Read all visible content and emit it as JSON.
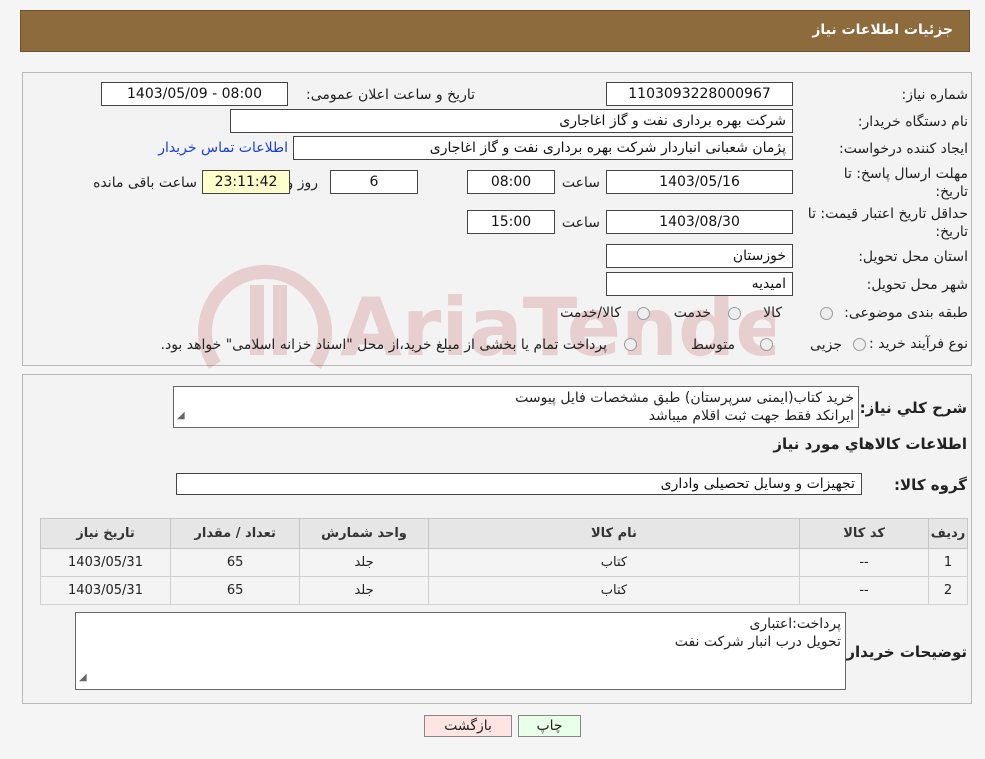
{
  "header": {
    "title": "جزئیات اطلاعات نیاز"
  },
  "form": {
    "need_number_label": "شماره نیاز:",
    "need_number": "1103093228000967",
    "announce_label": "تاریخ و ساعت اعلان عمومی:",
    "announce_value": "1403/05/09 - 08:00",
    "buyer_org_label": "نام دستگاه خریدار:",
    "buyer_org": "شرکت بهره برداری نفت و گاز اغاجاری",
    "creator_label": "ایجاد کننده درخواست:",
    "creator": "پژمان شعبانی انباردار شرکت بهره برداری نفت و گاز اغاجاری",
    "contact_link": "اطلاعات تماس خریدار",
    "deadline_label_1": "مهلت ارسال پاسخ: تا",
    "deadline_label_2": "تاریخ:",
    "deadline_date": "1403/05/16",
    "time_label": "ساعت",
    "deadline_time": "08:00",
    "days_value": "6",
    "days_label": "روز و",
    "remaining_time": "23:11:42",
    "remaining_label": "ساعت باقی مانده",
    "validity_label_1": "حداقل تاریخ اعتبار قیمت: تا",
    "validity_label_2": "تاریخ:",
    "validity_date": "1403/08/30",
    "validity_time": "15:00",
    "province_label": "استان محل تحویل:",
    "province": "خوزستان",
    "city_label": "شهر محل تحویل:",
    "city": "امیدیه",
    "category_label": "طبقه بندی موضوعی:",
    "category_options": [
      "کالا",
      "خدمت",
      "کالا/خدمت"
    ],
    "process_label": "نوع فرآیند خرید :",
    "process_options": [
      "جزیی",
      "متوسط"
    ],
    "process_note": "پرداخت تمام یا بخشی از مبلغ خرید،از محل \"اسناد خزانه اسلامی\" خواهد بود."
  },
  "details": {
    "description_label": "شرح کلي نياز:",
    "description_line1": "خرید کتاب(ایمنی سرپرستان) طبق مشخصات فایل پیوست",
    "description_line2": "ایرانکد فقط جهت ثبت اقلام میباشد",
    "goods_info_title": "اطلاعات کالاهاي مورد نياز",
    "goods_group_label": "گروه کالا:",
    "goods_group": "تجهیزات و وسایل تحصیلی واداری",
    "table": {
      "headers": [
        "رديف",
        "کد کالا",
        "نام کالا",
        "واحد شمارش",
        "تعداد / مقدار",
        "تاریخ نیاز"
      ],
      "rows": [
        [
          "1",
          "--",
          "کتاب",
          "جلد",
          "65",
          "1403/05/31"
        ],
        [
          "2",
          "--",
          "کتاب",
          "جلد",
          "65",
          "1403/05/31"
        ]
      ]
    },
    "buyer_notes_label": "توضیحات خریدار:",
    "buyer_notes_line1": "پرداخت:اعتباری",
    "buyer_notes_line2": "تحویل درب انبار شرکت نفت"
  },
  "buttons": {
    "print": "چاپ",
    "back": "بازگشت"
  },
  "watermark_text": "AriaTender.neT",
  "colors": {
    "header": "#8d6b3c",
    "link": "#1a3fd6",
    "yellow": "#ffffcc",
    "print_btn": "#eaffea",
    "back_btn": "#ffe4e4"
  }
}
